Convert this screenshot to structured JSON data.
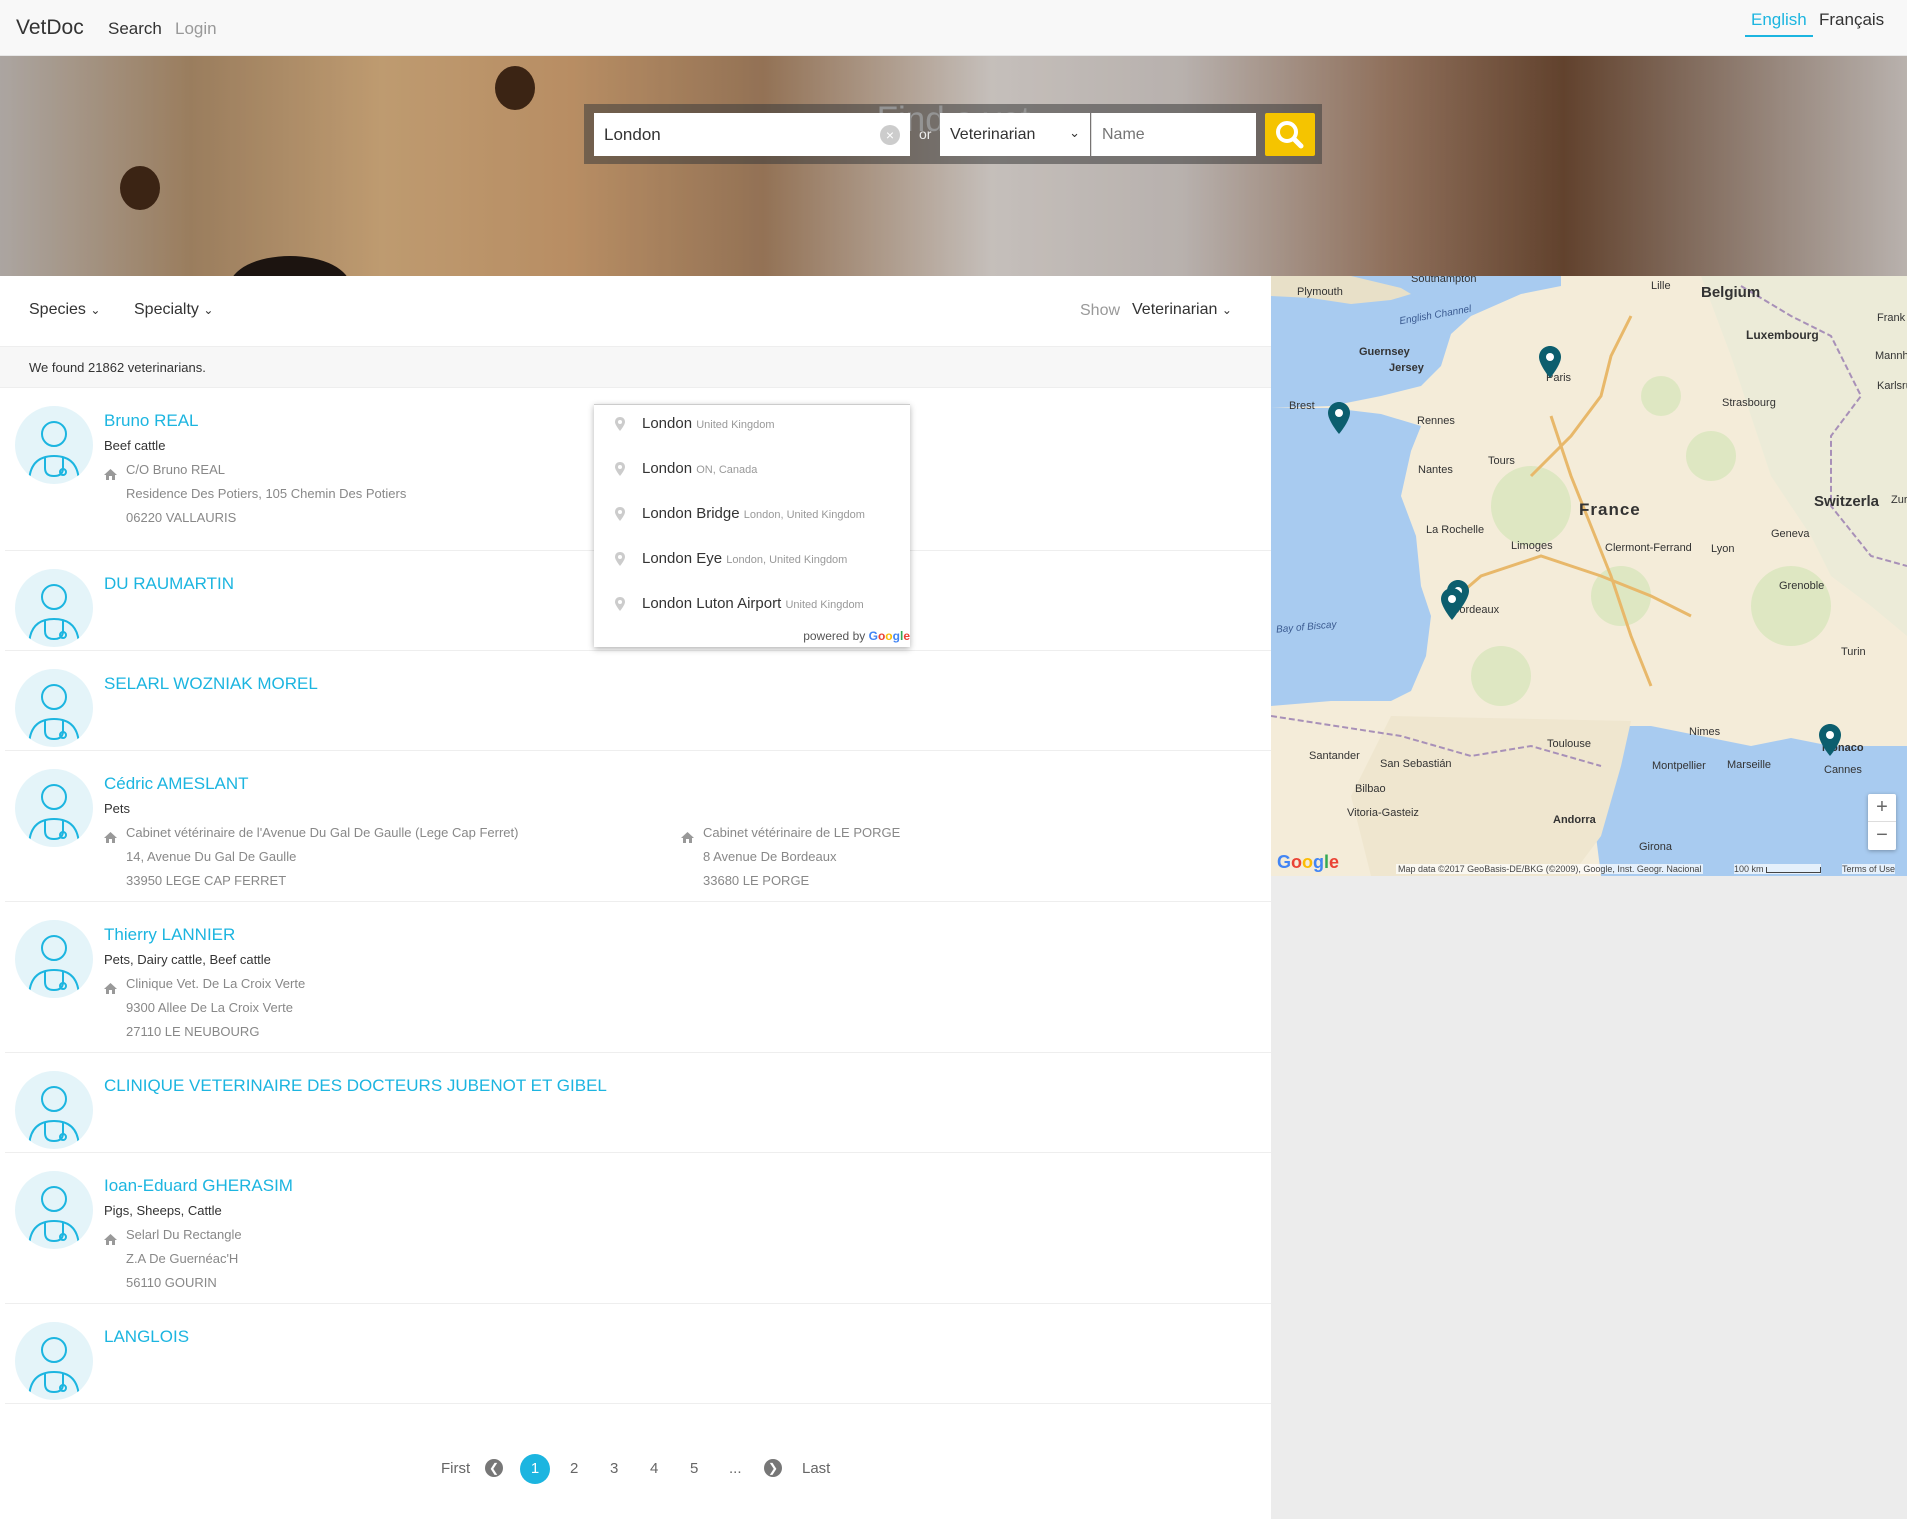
{
  "nav": {
    "brand": "VetDoc",
    "search": "Search",
    "login": "Login",
    "lang_en": "English",
    "lang_fr": "Français"
  },
  "hero": {
    "title": "Find a vet"
  },
  "search": {
    "location_value": "London",
    "or": "or",
    "type_selected": "Veterinarian",
    "name_placeholder": "Name"
  },
  "filters": {
    "species": "Species",
    "specialty": "Specialty",
    "show_label": "Show",
    "show_value": "Veterinarian"
  },
  "count_text": "We found 21862 veterinarians.",
  "autocomplete": {
    "items": [
      {
        "main": "London",
        "secondary": "United Kingdom"
      },
      {
        "main": "London",
        "secondary": "ON, Canada"
      },
      {
        "main": "London Bridge",
        "secondary": "London, United Kingdom"
      },
      {
        "main": "London Eye",
        "secondary": "London, United Kingdom"
      },
      {
        "main": "London Luton Airport",
        "secondary": "United Kingdom"
      }
    ],
    "powered_by": "powered by",
    "google": [
      "G",
      "o",
      "o",
      "g",
      "l",
      "e"
    ]
  },
  "results": [
    {
      "name": "Bruno REAL",
      "species": "Beef cattle",
      "addresses": [
        {
          "l1": "C/O Bruno REAL",
          "l2": "Residence Des Potiers, 105 Chemin Des Potiers",
          "l3": "06220 VALLAURIS"
        }
      ]
    },
    {
      "name": "DU RAUMARTIN",
      "species": "",
      "addresses": []
    },
    {
      "name": "SELARL WOZNIAK MOREL",
      "species": "",
      "addresses": []
    },
    {
      "name": "Cédric AMESLANT",
      "species": "Pets",
      "addresses": [
        {
          "l1": "Cabinet vétérinaire de l'Avenue Du Gal De Gaulle (Lege Cap Ferret)",
          "l2": "14, Avenue Du Gal De Gaulle",
          "l3": "33950 LEGE CAP FERRET"
        },
        {
          "l1": "Cabinet vétérinaire de LE PORGE",
          "l2": "8 Avenue De Bordeaux",
          "l3": "33680 LE PORGE"
        }
      ]
    },
    {
      "name": "Thierry LANNIER",
      "species": "Pets, Dairy cattle, Beef cattle",
      "addresses": [
        {
          "l1": "Clinique Vet. De La Croix Verte",
          "l2": "9300 Allee De La Croix Verte",
          "l3": "27110 LE NEUBOURG"
        }
      ]
    },
    {
      "name": "CLINIQUE VETERINAIRE DES DOCTEURS JUBENOT ET GIBEL",
      "species": "",
      "addresses": []
    },
    {
      "name": "Ioan-Eduard GHERASIM",
      "species": "Pigs, Sheeps, Cattle",
      "addresses": [
        {
          "l1": "Selarl Du Rectangle",
          "l2": "Z.A De Guernéac'H",
          "l3": "56110 GOURIN"
        }
      ]
    },
    {
      "name": "LANGLOIS",
      "species": "",
      "addresses": []
    }
  ],
  "map": {
    "labels": {
      "belgium": "Belgium",
      "luxembourg": "Luxembourg",
      "france": "France",
      "switzerland": "Switzerla",
      "plymouth": "Plymouth",
      "southampton": "Southampton",
      "lille": "Lille",
      "english_channel": "English Channel",
      "guernsey": "Guernsey",
      "jersey": "Jersey",
      "paris": "Paris",
      "brest": "Brest",
      "rennes": "Rennes",
      "strasbourg": "Strasbourg",
      "nantes": "Nantes",
      "tours": "Tours",
      "la_rochelle": "La Rochelle",
      "limoges": "Limoges",
      "clermont": "Clermont-Ferrand",
      "lyon": "Lyon",
      "geneva": "Geneva",
      "bordeaux": "Bordeaux",
      "bay_biscay": "Bay of Biscay",
      "grenoble": "Grenoble",
      "turin": "Turin",
      "toulouse": "Toulouse",
      "nimes": "Nimes",
      "montpellier": "Montpellier",
      "marseille": "Marseille",
      "monaco": "Monaco",
      "cannes": "Cannes",
      "santander": "Santander",
      "san_sebastian": "San Sebastián",
      "bilbao": "Bilbao",
      "vitoria": "Vitoria-Gasteiz",
      "andorra": "Andorra",
      "girona": "Girona",
      "zurich": "Zuric",
      "mannheim": "Mannhe",
      "karlsruhe": "Karlsru",
      "frank": "Frank"
    },
    "zoom_in": "+",
    "zoom_out": "−",
    "attribution": "Map data ©2017 GeoBasis-DE/BKG (©2009), Google, Inst. Geogr. Nacional",
    "scale": "100 km",
    "terms": "Terms of Use",
    "google": [
      "G",
      "o",
      "o",
      "g",
      "l",
      "e"
    ]
  },
  "pagination": {
    "first": "First",
    "pages": [
      "1",
      "2",
      "3",
      "4",
      "5"
    ],
    "ellipsis": "...",
    "last": "Last"
  },
  "colors": {
    "accent": "#1cb5e0",
    "search_button": "#f5c400",
    "marker": "#0c5e6e"
  }
}
